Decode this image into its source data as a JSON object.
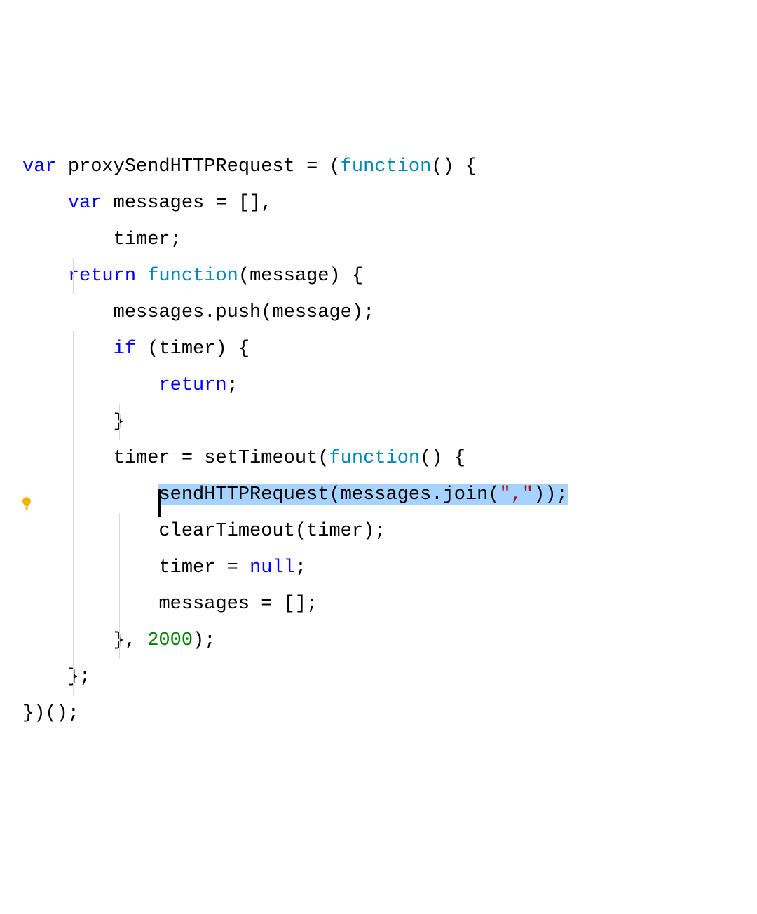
{
  "editor": {
    "lines": [
      {
        "indent": 0,
        "bulb": false,
        "caret": false,
        "tokens": [
          [
            "kw",
            "var"
          ],
          [
            "pn",
            " "
          ],
          [
            "id",
            "proxySendHTTPRequest"
          ],
          [
            "pn",
            " "
          ],
          [
            "pn",
            "="
          ],
          [
            "pn",
            " "
          ],
          [
            "pn",
            "("
          ],
          [
            "fn",
            "function"
          ],
          [
            "pn",
            "()"
          ],
          [
            "pn",
            " "
          ],
          [
            "pn",
            "{"
          ]
        ]
      },
      {
        "indent": 1,
        "bulb": false,
        "caret": false,
        "tokens": [
          [
            "kw",
            "var"
          ],
          [
            "pn",
            " "
          ],
          [
            "id",
            "messages"
          ],
          [
            "pn",
            " "
          ],
          [
            "pn",
            "="
          ],
          [
            "pn",
            " "
          ],
          [
            "pn",
            "[],"
          ]
        ]
      },
      {
        "indent": 2,
        "bulb": false,
        "caret": false,
        "tokens": [
          [
            "id",
            "timer"
          ],
          [
            "pn",
            ";"
          ]
        ]
      },
      {
        "indent": 1,
        "bulb": false,
        "caret": false,
        "tokens": [
          [
            "kw",
            "return"
          ],
          [
            "pn",
            " "
          ],
          [
            "fn",
            "function"
          ],
          [
            "pn",
            "("
          ],
          [
            "id",
            "message"
          ],
          [
            "pn",
            ")"
          ],
          [
            "pn",
            " "
          ],
          [
            "pn",
            "{"
          ]
        ]
      },
      {
        "indent": 2,
        "bulb": false,
        "caret": false,
        "tokens": [
          [
            "id",
            "messages"
          ],
          [
            "pn",
            "."
          ],
          [
            "id",
            "push"
          ],
          [
            "pn",
            "("
          ],
          [
            "id",
            "message"
          ],
          [
            "pn",
            ");"
          ]
        ]
      },
      {
        "indent": 2,
        "bulb": false,
        "caret": false,
        "tokens": [
          [
            "kw",
            "if"
          ],
          [
            "pn",
            " "
          ],
          [
            "pn",
            "("
          ],
          [
            "id",
            "timer"
          ],
          [
            "pn",
            ")"
          ],
          [
            "pn",
            " "
          ],
          [
            "pn",
            "{"
          ]
        ]
      },
      {
        "indent": 3,
        "bulb": false,
        "caret": false,
        "tokens": [
          [
            "kw",
            "return"
          ],
          [
            "pn",
            ";"
          ]
        ]
      },
      {
        "indent": 2,
        "bulb": false,
        "caret": false,
        "tokens": [
          [
            "pn",
            "}"
          ]
        ]
      },
      {
        "indent": 2,
        "bulb": false,
        "caret": false,
        "tokens": [
          [
            "id",
            "timer"
          ],
          [
            "pn",
            " "
          ],
          [
            "pn",
            "="
          ],
          [
            "pn",
            " "
          ],
          [
            "id",
            "setTimeout"
          ],
          [
            "pn",
            "("
          ],
          [
            "fn",
            "function"
          ],
          [
            "pn",
            "()"
          ],
          [
            "pn",
            " "
          ],
          [
            "pn",
            "{"
          ]
        ]
      },
      {
        "indent": 3,
        "bulb": true,
        "caret": true,
        "select": true,
        "tokens": [
          [
            "id",
            "sendHTTPRequest"
          ],
          [
            "pn",
            "("
          ],
          [
            "id",
            "messages"
          ],
          [
            "pn",
            "."
          ],
          [
            "id",
            "join"
          ],
          [
            "pn",
            "("
          ],
          [
            "str",
            "\",\""
          ],
          [
            "pn",
            "));"
          ]
        ]
      },
      {
        "indent": 3,
        "bulb": false,
        "caret": false,
        "tokens": [
          [
            "id",
            "clearTimeout"
          ],
          [
            "pn",
            "("
          ],
          [
            "id",
            "timer"
          ],
          [
            "pn",
            ");"
          ]
        ]
      },
      {
        "indent": 3,
        "bulb": false,
        "caret": false,
        "tokens": [
          [
            "id",
            "timer"
          ],
          [
            "pn",
            " "
          ],
          [
            "pn",
            "="
          ],
          [
            "pn",
            " "
          ],
          [
            "kw",
            "null"
          ],
          [
            "pn",
            ";"
          ]
        ]
      },
      {
        "indent": 3,
        "bulb": false,
        "caret": false,
        "tokens": [
          [
            "id",
            "messages"
          ],
          [
            "pn",
            " "
          ],
          [
            "pn",
            "="
          ],
          [
            "pn",
            " "
          ],
          [
            "pn",
            "[];"
          ]
        ]
      },
      {
        "indent": 2,
        "bulb": false,
        "caret": false,
        "tokens": [
          [
            "pn",
            "},"
          ],
          [
            "pn",
            " "
          ],
          [
            "num",
            "2000"
          ],
          [
            "pn",
            ");"
          ]
        ]
      },
      {
        "indent": 1,
        "bulb": false,
        "caret": false,
        "tokens": [
          [
            "pn",
            "};"
          ]
        ]
      },
      {
        "indent": 0,
        "bulb": false,
        "caret": false,
        "tokens": [
          [
            "pn",
            "})();"
          ]
        ]
      }
    ],
    "indentUnit": 4,
    "bulbIconName": "lightbulb-icon"
  }
}
